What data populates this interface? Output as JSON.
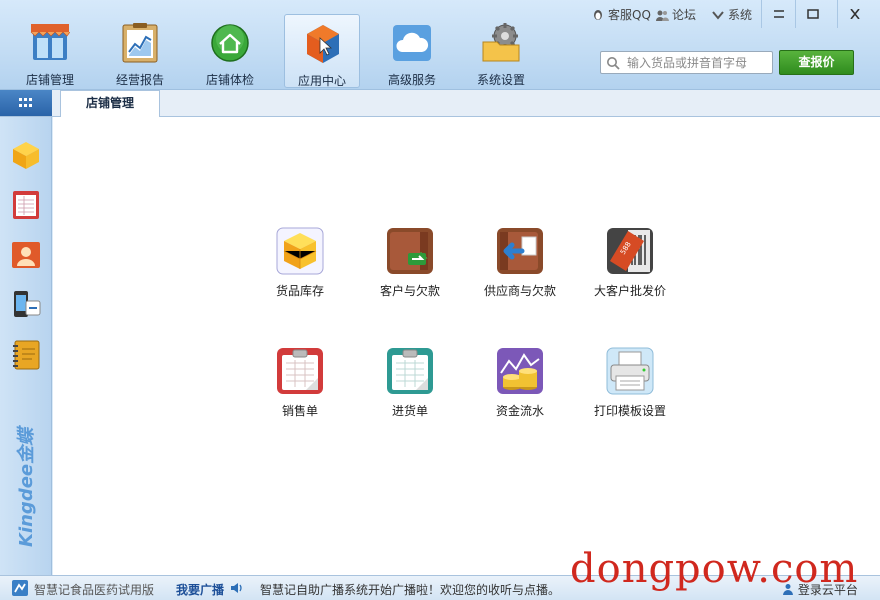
{
  "nav": [
    {
      "id": "store",
      "label": "店铺管理"
    },
    {
      "id": "report",
      "label": "经营报告"
    },
    {
      "id": "check",
      "label": "店铺体检"
    },
    {
      "id": "apps",
      "label": "应用中心"
    },
    {
      "id": "advanced",
      "label": "高级服务"
    },
    {
      "id": "settings",
      "label": "系统设置"
    }
  ],
  "active_nav": "apps",
  "top_links": {
    "service": "客服QQ",
    "forum": "论坛",
    "system": "系统"
  },
  "search": {
    "placeholder": "输入货品或拼音首字母",
    "button": "查报价"
  },
  "tabs": [
    {
      "label": "店铺管理"
    }
  ],
  "apps": [
    {
      "label": "货品库存",
      "icon": "cubes-icon"
    },
    {
      "label": "客户与欠款",
      "icon": "customer-ledger-icon"
    },
    {
      "label": "供应商与欠款",
      "icon": "supplier-ledger-icon"
    },
    {
      "label": "大客户批发价",
      "icon": "wholesale-price-icon"
    },
    {
      "label": "销售单",
      "icon": "sales-order-icon"
    },
    {
      "label": "进货单",
      "icon": "purchase-order-icon"
    },
    {
      "label": "资金流水",
      "icon": "cash-flow-icon"
    },
    {
      "label": "打印模板设置",
      "icon": "printer-icon"
    }
  ],
  "brand": "Kingdee金蝶",
  "status": {
    "version": "智慧记食品医药试用版",
    "broadcast_btn": "我要广播",
    "broadcast_text": "智慧记自助广播系统开始广播啦！欢迎您的收听与点播。",
    "cloud_login": "登录云平台"
  },
  "watermark": "dongpow.com",
  "colors": {
    "accent": "#2f8c1e",
    "tab_blue": "#2a63a8",
    "watermark": "#d0281e"
  }
}
